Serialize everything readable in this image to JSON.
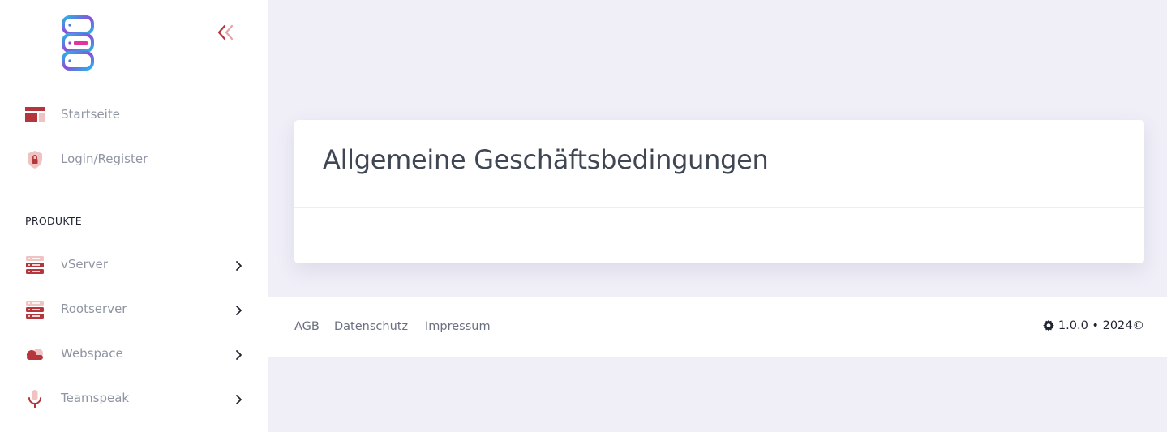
{
  "sidebar": {
    "collapse_icon": "chevrons-left-icon",
    "items": [
      {
        "label": "Startseite",
        "icon": "layout-icon"
      },
      {
        "label": "Login/Register",
        "icon": "shield-lock-icon"
      }
    ],
    "section_title": "PRODUKTE",
    "products": [
      {
        "label": "vServer",
        "icon": "server-icon"
      },
      {
        "label": "Rootserver",
        "icon": "server-icon"
      },
      {
        "label": "Webspace",
        "icon": "cloud-icon"
      },
      {
        "label": "Teamspeak",
        "icon": "microphone-icon"
      }
    ]
  },
  "main": {
    "title": "Allgemeine Geschäftsbedingungen"
  },
  "footer": {
    "links": [
      "AGB",
      "Datenschutz",
      "Impressum"
    ],
    "version_text": "1.0.0 • 2024©"
  },
  "colors": {
    "accent": "#b4363c",
    "accent_light": "#f0c3c3",
    "background": "#f0eff8"
  }
}
